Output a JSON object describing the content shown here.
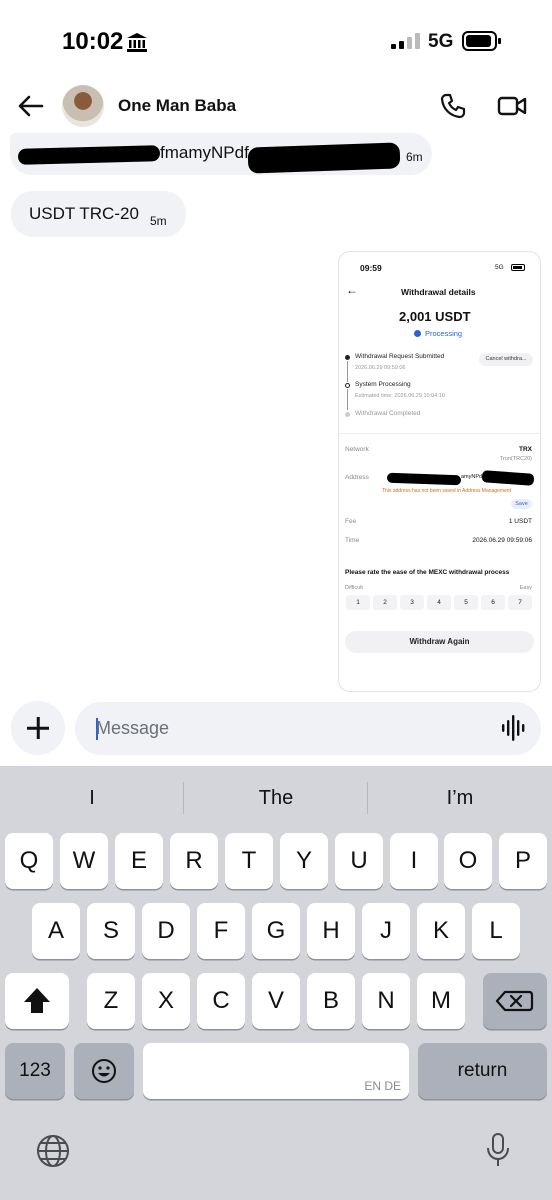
{
  "status_bar": {
    "time": "10:02",
    "network": "5G"
  },
  "chat": {
    "contact_name": "One Man Baba",
    "messages": [
      {
        "text": "fmamyNPdf",
        "time": "6m"
      },
      {
        "text": "USDT TRC-20",
        "time": "5m"
      }
    ]
  },
  "attached_screenshot": {
    "time": "09:59",
    "network": "5G",
    "title": "Withdrawal details",
    "amount": "2,001 USDT",
    "status": "Processing",
    "cancel_label": "Cancel withdra...",
    "steps": [
      {
        "title": "Withdrawal Request Submitted",
        "sub": "2026.06.29 09:59:06"
      },
      {
        "title": "System Processing",
        "sub": "Estimated time: 2026.06.29 10:04:10"
      },
      {
        "title": "Withdrawal Completed",
        "sub": ""
      }
    ],
    "network_label": "Network",
    "network_value": "TRX",
    "network_sub": "Tron(TRC20)",
    "address_label": "Address",
    "address_fragment": "amyNPd",
    "address_warning": "This address has not been saved in Address Management",
    "save_label": "Save",
    "fee_label": "Fee",
    "fee_value": "1 USDT",
    "time_label": "Time",
    "time_value": "2026.06.29 09:59:06",
    "rate_prompt": "Please rate the ease of the MEXC withdrawal process",
    "difficult_label": "Difficult",
    "easy_label": "Easy",
    "rating_options": [
      "1",
      "2",
      "3",
      "4",
      "5",
      "6",
      "7"
    ],
    "withdraw_again_label": "Withdraw Again"
  },
  "composer": {
    "placeholder": "Message"
  },
  "keyboard": {
    "suggestions": [
      "I",
      "The",
      "I’m"
    ],
    "row1": [
      "Q",
      "W",
      "E",
      "R",
      "T",
      "Y",
      "U",
      "I",
      "O",
      "P"
    ],
    "row2": [
      "A",
      "S",
      "D",
      "F",
      "G",
      "H",
      "J",
      "K",
      "L"
    ],
    "row3": [
      "Z",
      "X",
      "C",
      "V",
      "B",
      "N",
      "M"
    ],
    "numbers_label": "123",
    "space_lang": "EN DE",
    "return_label": "return"
  }
}
